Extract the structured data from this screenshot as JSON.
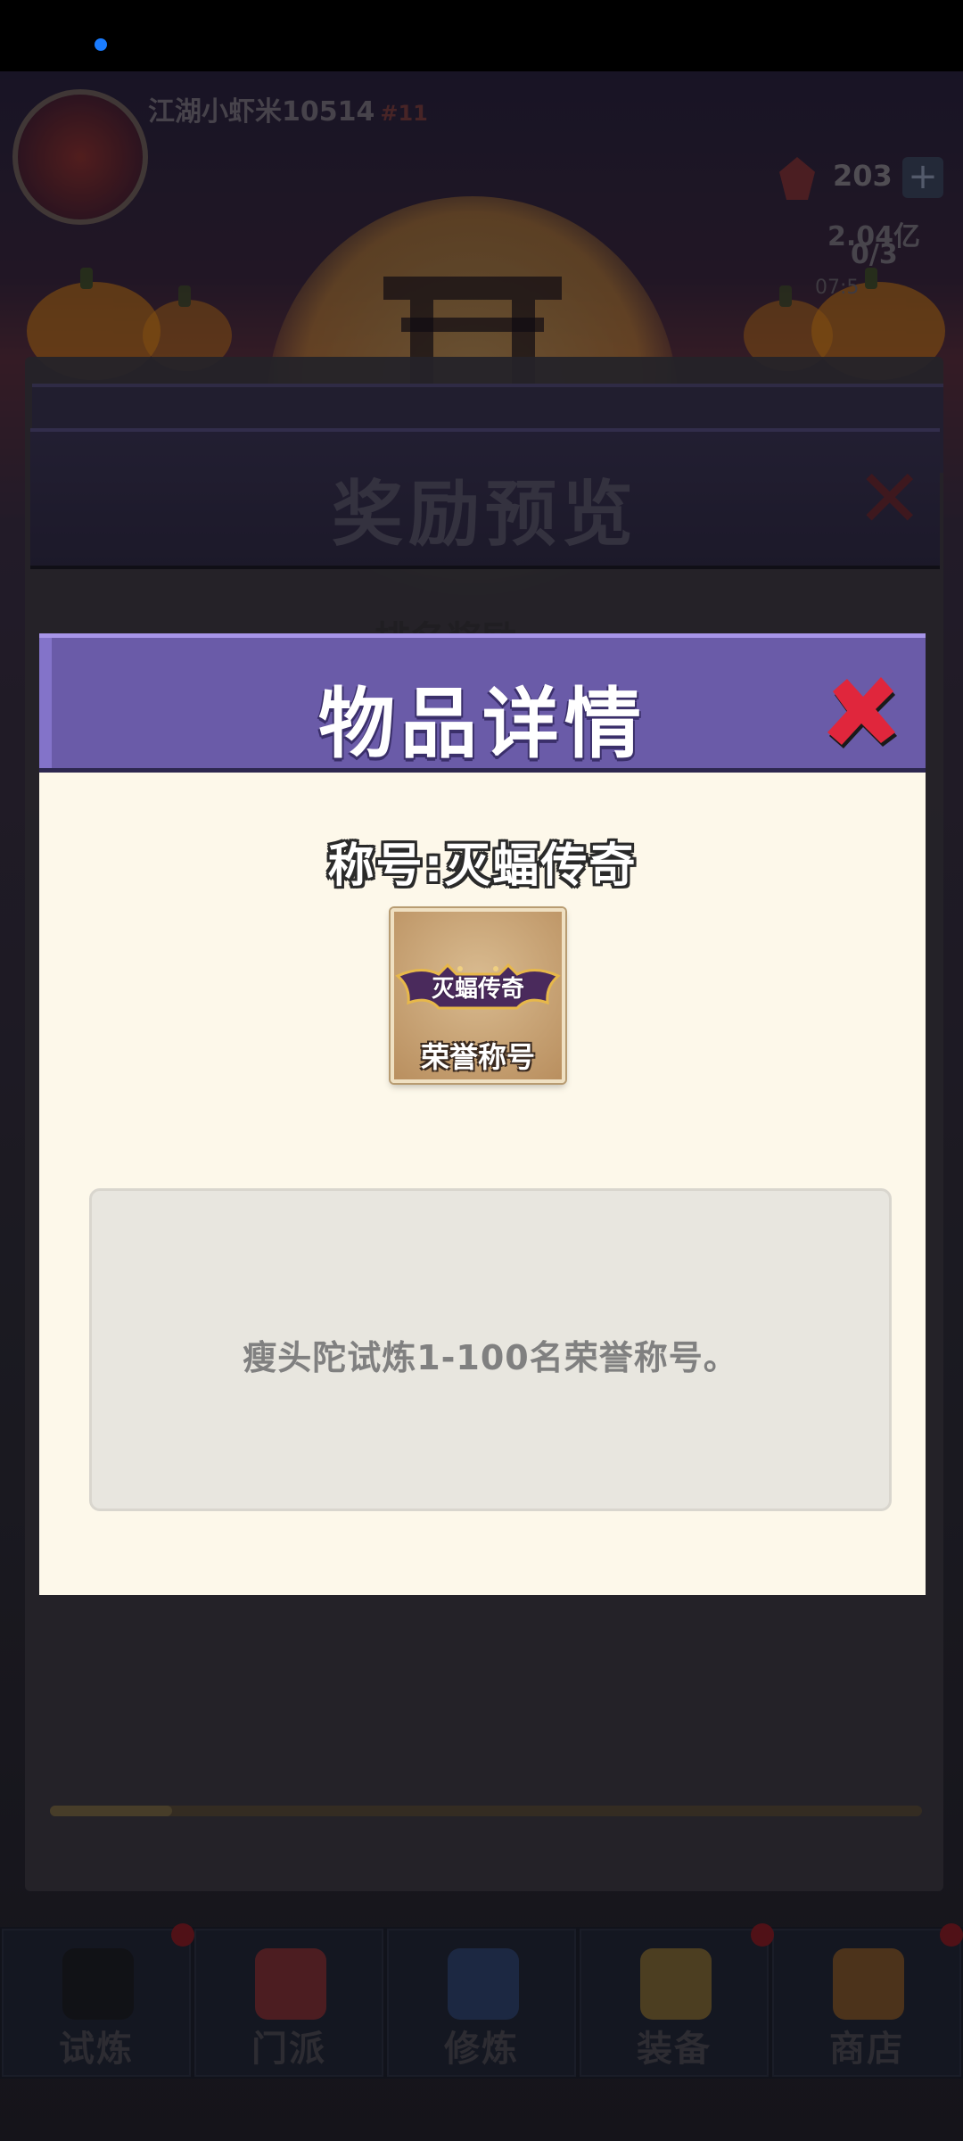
{
  "background": {
    "player_name": "江湖小虾米10514",
    "player_id_label": "#11",
    "gems": "203",
    "plus_label": "+",
    "gold": "2.04亿",
    "tickets": "0/3",
    "timer_partial": "07:5",
    "reward_preview_title": "奖励预览",
    "rank_reward_tab": "排名奖励"
  },
  "nav": {
    "items": [
      {
        "label": "试炼",
        "icon": "ninja-icon",
        "color": "#1a1a1a"
      },
      {
        "label": "门派",
        "icon": "temple-icon",
        "color": "#c43a3a"
      },
      {
        "label": "修炼",
        "icon": "book-icon",
        "color": "#3a5a9a"
      },
      {
        "label": "装备",
        "icon": "sword-icon",
        "color": "#c49a3a"
      },
      {
        "label": "商店",
        "icon": "shop-icon",
        "color": "#c47a2a"
      }
    ]
  },
  "modal": {
    "title": "物品详情",
    "item_name": "称号:灭蝠传奇",
    "icon_title_text": "灭蝠传奇",
    "icon_type_text": "荣誉称号",
    "description": "瘦头陀试炼1-100名荣誉称号。"
  },
  "colors": {
    "header_purple": "#6a5ba8",
    "close_red": "#e0263c",
    "body_cream": "#fdf8ea"
  }
}
